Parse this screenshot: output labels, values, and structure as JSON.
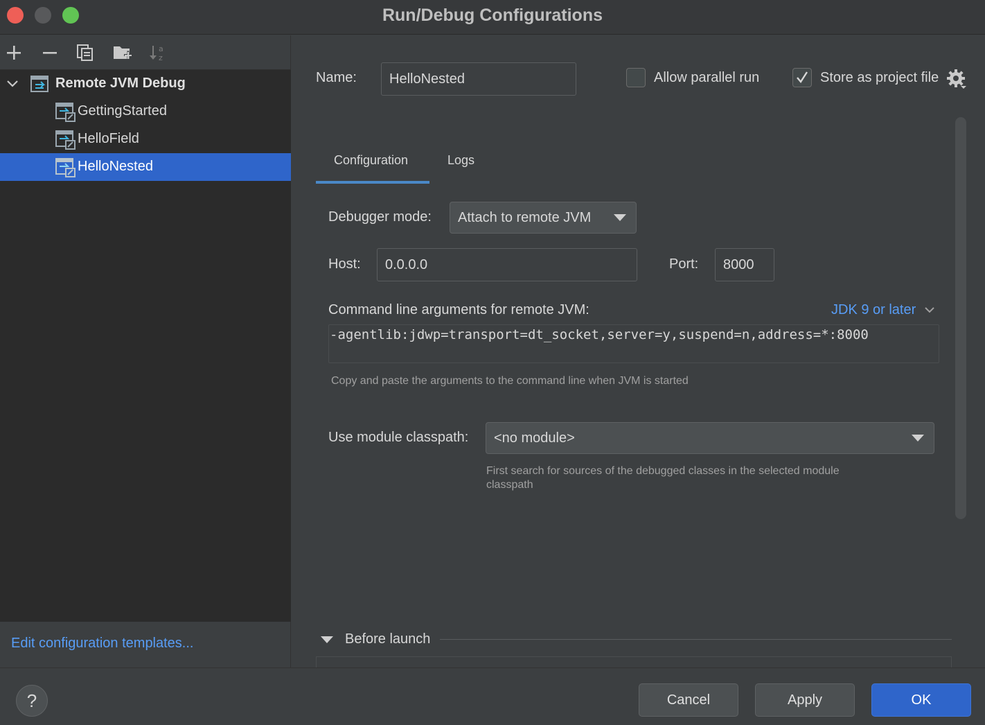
{
  "window": {
    "title": "Run/Debug Configurations"
  },
  "toolbar": {
    "add_icon": "plus-icon",
    "remove_icon": "minus-icon",
    "copy_icon": "copy-icon",
    "new_folder_icon": "folder-plus-icon",
    "sort_icon": "sort-alpha-icon"
  },
  "tree": {
    "group": {
      "label": "Remote JVM Debug",
      "expanded": true
    },
    "items": [
      {
        "label": "GettingStarted",
        "selected": false
      },
      {
        "label": "HelloField",
        "selected": false
      },
      {
        "label": "HelloNested",
        "selected": true
      }
    ]
  },
  "left_footer": {
    "edit_templates": "Edit configuration templates..."
  },
  "header": {
    "name_label": "Name:",
    "name_value": "HelloNested",
    "allow_parallel_label": "Allow parallel run",
    "allow_parallel_checked": false,
    "store_project_label": "Store as project file",
    "store_project_checked": true
  },
  "tabs": [
    {
      "label": "Configuration",
      "active": true
    },
    {
      "label": "Logs",
      "active": false
    }
  ],
  "config": {
    "debugger_mode_label": "Debugger mode:",
    "debugger_mode_value": "Attach to remote JVM",
    "host_label": "Host:",
    "host_value": "0.0.0.0",
    "port_label": "Port:",
    "port_value": "8000",
    "args_label": "Command line arguments for remote JVM:",
    "jdk_link": "JDK 9 or later",
    "args_value": "-agentlib:jdwp=transport=dt_socket,server=y,suspend=n,address=*:8000",
    "args_hint": "Copy and paste the arguments to the command line when JVM is started",
    "module_label": "Use module classpath:",
    "module_value": "<no module>",
    "module_hint": "First search for sources of the debugged classes in the selected module classpath"
  },
  "before_launch": {
    "label": "Before launch"
  },
  "buttons": {
    "help": "?",
    "cancel": "Cancel",
    "apply": "Apply",
    "ok": "OK"
  },
  "colors": {
    "accent": "#2f65ca",
    "link": "#589df6",
    "background": "#3c3f41",
    "tree_background": "#2b2b2b"
  }
}
